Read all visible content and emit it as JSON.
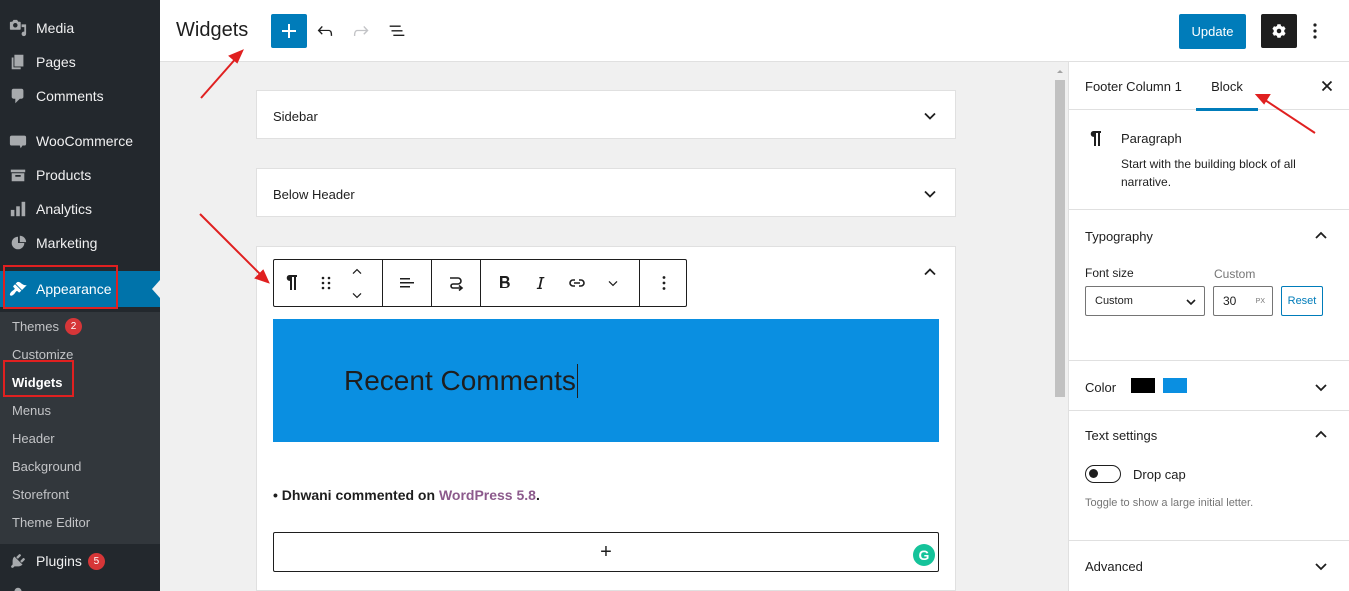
{
  "sidebar": {
    "items": [
      {
        "label": "Media",
        "icon": "media-icon"
      },
      {
        "label": "Pages",
        "icon": "pages-icon"
      },
      {
        "label": "Comments",
        "icon": "comments-icon"
      },
      {
        "label": "WooCommerce",
        "icon": "woocommerce-icon"
      },
      {
        "label": "Products",
        "icon": "products-icon"
      },
      {
        "label": "Analytics",
        "icon": "analytics-icon"
      },
      {
        "label": "Marketing",
        "icon": "marketing-icon"
      },
      {
        "label": "Appearance",
        "icon": "appearance-icon"
      },
      {
        "label": "Plugins",
        "icon": "plugins-icon",
        "badge": "5"
      }
    ],
    "submenu": [
      {
        "label": "Themes",
        "badge": "2"
      },
      {
        "label": "Customize"
      },
      {
        "label": "Widgets"
      },
      {
        "label": "Menus"
      },
      {
        "label": "Header"
      },
      {
        "label": "Background"
      },
      {
        "label": "Storefront"
      },
      {
        "label": "Theme Editor"
      }
    ]
  },
  "header": {
    "title": "Widgets",
    "update_label": "Update"
  },
  "canvas": {
    "widget_areas": [
      {
        "title": "Sidebar"
      },
      {
        "title": "Below Header"
      }
    ],
    "heading_text": "Recent Comments",
    "comment": {
      "author": "Dhwani",
      "middle": " commented on ",
      "post_link": "WordPress 5.8",
      "end": "."
    },
    "appender_symbol": "+"
  },
  "inspector": {
    "tabs": [
      "Footer Column 1",
      "Block"
    ],
    "block": {
      "name": "Paragraph",
      "description": "Start with the building block of all narrative."
    },
    "typography": {
      "title": "Typography",
      "font_size_label": "Font size",
      "custom_label": "Custom",
      "select_value": "Custom",
      "number_value": "30",
      "unit": "PX",
      "reset_label": "Reset"
    },
    "color": {
      "title": "Color",
      "text_color": "#000000",
      "background_color": "#0a8fe1"
    },
    "text_settings": {
      "title": "Text settings",
      "drop_cap_label": "Drop cap",
      "help": "Toggle to show a large initial letter."
    },
    "advanced": {
      "title": "Advanced"
    }
  },
  "colors": {
    "sidebar_bg": "#23282d",
    "accent": "#007cba",
    "heading_block_bg": "#0a8fe1",
    "annotation": "#e02020"
  }
}
